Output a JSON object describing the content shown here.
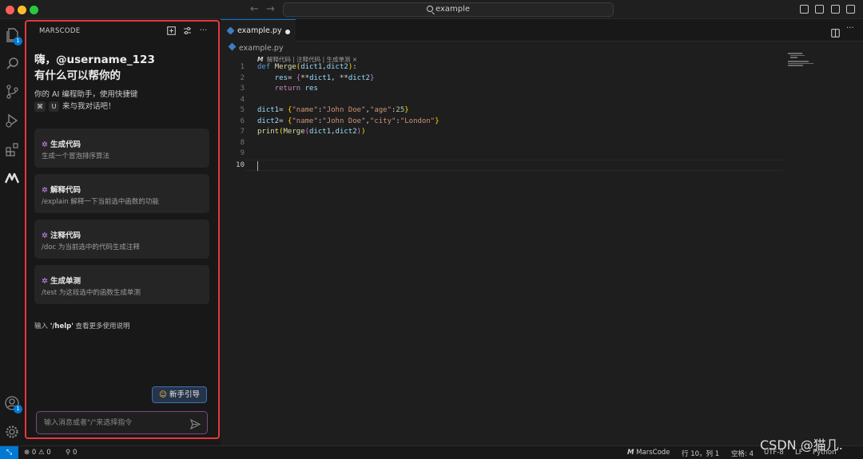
{
  "titlebar": {
    "search_text": "example",
    "traffic_lights": [
      "close",
      "minimize",
      "zoom"
    ]
  },
  "activity_bar": {
    "icons": [
      "explorer-icon",
      "search-icon",
      "source-control-icon",
      "run-debug-icon",
      "extensions-icon",
      "marscode-icon"
    ],
    "explorer_badge": "1",
    "account_badge": "1"
  },
  "sidebar": {
    "panel_title": "MARSCODE",
    "greeting_line1": "嗨，@username_123",
    "greeting_line2": "有什么可以帮你的",
    "intro_line1": "你的 AI 编程助手，使用快捷键",
    "kbd_cmd": "⌘",
    "kbd_u": "U",
    "intro_line2_tail": "来与我对话吧！",
    "cards": [
      {
        "title": "生成代码",
        "desc": "生成一个冒泡排序算法"
      },
      {
        "title": "解释代码",
        "desc": "/explain 解释一下当前选中函数的功能"
      },
      {
        "title": "注释代码",
        "desc": "/doc 为当前选中的代码生成注释"
      },
      {
        "title": "生成单测",
        "desc": "/test 为这段选中的函数生成单测"
      }
    ],
    "help_prefix": "输入",
    "help_cmd": "'/help'",
    "help_suffix": "查看更多使用说明",
    "guide_button": "新手引导",
    "chat_placeholder": "输入消息或者\"/\"来选择指令"
  },
  "editor": {
    "tab_name": "example.py",
    "tab_modified": true,
    "breadcrumb": "example.py",
    "codelens_items": [
      "解释代码",
      "注释代码",
      "生成单测"
    ],
    "codelens_separator": "|",
    "codelens_close": "×",
    "line_numbers": [
      "1",
      "2",
      "3",
      "4",
      "5",
      "6",
      "7",
      "8",
      "9",
      "10"
    ],
    "active_line": "10",
    "code_lines": [
      "def Merge(dict1,dict2):",
      "    res= {**dict1, **dict2}",
      "    return res",
      "",
      "dict1= {\"name\":\"John Doe\",\"age\":25}",
      "dict2= {\"name\":\"John Doe\",\"city\":\"London\"}",
      "print(Merge(dict1,dict2))",
      "",
      "",
      ""
    ]
  },
  "statusbar": {
    "errors": "0",
    "warnings": "0",
    "ports": "0",
    "marscode": "MarsCode",
    "cursor_position": "行 10，列 1",
    "indent": "空格: 4",
    "encoding": "UTF-8",
    "eol": "LF",
    "language": "Python"
  },
  "watermark": "CSDN @猫几."
}
